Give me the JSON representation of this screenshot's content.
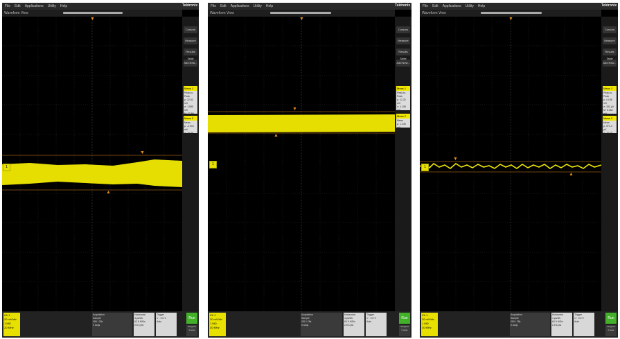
{
  "menu": [
    "File",
    "Edit",
    "Applications",
    "Utility",
    "Help"
  ],
  "brand": "Tektronix",
  "window_title": "Waveform View",
  "side_buttons": [
    "Cursors",
    "Callout",
    "Measure",
    "Search",
    "Results Table",
    "Plot",
    "Add New..."
  ],
  "panels": [
    {
      "name": "scope-1",
      "ch1_box": {
        "title": "Meas 1",
        "lines": [
          "Peak-to-Peak",
          "μ: 22.52 mV",
          "σ: 1.585 mV",
          "M: 22.89 mV",
          "m: 19.66 mV",
          "n: 1.000"
        ]
      },
      "ch2_box": {
        "title": "Meas 2",
        "lines": [
          "Mean",
          "μ: -2.001 mV",
          "σ: 16.95 μV"
        ]
      },
      "level_marker": "1",
      "ylabels": [
        "-200",
        "-100",
        "0",
        "100",
        "200"
      ]
    },
    {
      "name": "scope-2",
      "ch1_box": {
        "title": "Meas 1",
        "lines": [
          "Peak-to-Peak",
          "μ: 12.32 mV",
          "σ: 1.108 mV",
          "M: 14.52 mV",
          "m: 10.11 mV"
        ]
      },
      "ch2_box": {
        "title": "Meas 2",
        "lines": [
          "Mean",
          "μ: 1.245 mV"
        ]
      },
      "level_marker": "1",
      "ylabels": [
        "-200",
        "-100",
        "0",
        "100",
        "200"
      ]
    },
    {
      "name": "scope-3",
      "ch1_box": {
        "title": "Meas 1",
        "lines": [
          "Peak-to-Peak",
          "μ: 4.195 mV",
          "σ: 332 μV",
          "M: 5.054 mV",
          "m: 3.380 mV",
          "n: 1.000"
        ]
      },
      "ch2_box": {
        "title": "Meas 2",
        "lines": [
          "Mean",
          "μ: 971.4 μV",
          "σ: 15.49 μV"
        ]
      },
      "level_marker": "1",
      "ylabels": [
        "-20",
        "-10",
        "0",
        "10",
        "20"
      ]
    }
  ],
  "bottom": {
    "ch1_lines": [
      "Ch 1",
      "20 mV/div",
      "1 MΩ",
      "20 MHz"
    ],
    "horizontal": [
      "Horizontal",
      "4 μs/div",
      "62.5 MS/s",
      "2.5 k pts"
    ],
    "trigger": [
      "Trigger",
      "1 ↑ 0.0 V",
      "Auto"
    ],
    "acquisition": [
      "Acquisition",
      "Sample",
      "250 / 25k",
      "0 acqs"
    ],
    "run_label": "Run",
    "stat_lines": [
      "Stopped",
      "0 acqs"
    ]
  },
  "colors": {
    "trace": "#f2ea00",
    "cursor": "#e08a1e",
    "grid": "#2e2e2e",
    "background": "#000000"
  }
}
